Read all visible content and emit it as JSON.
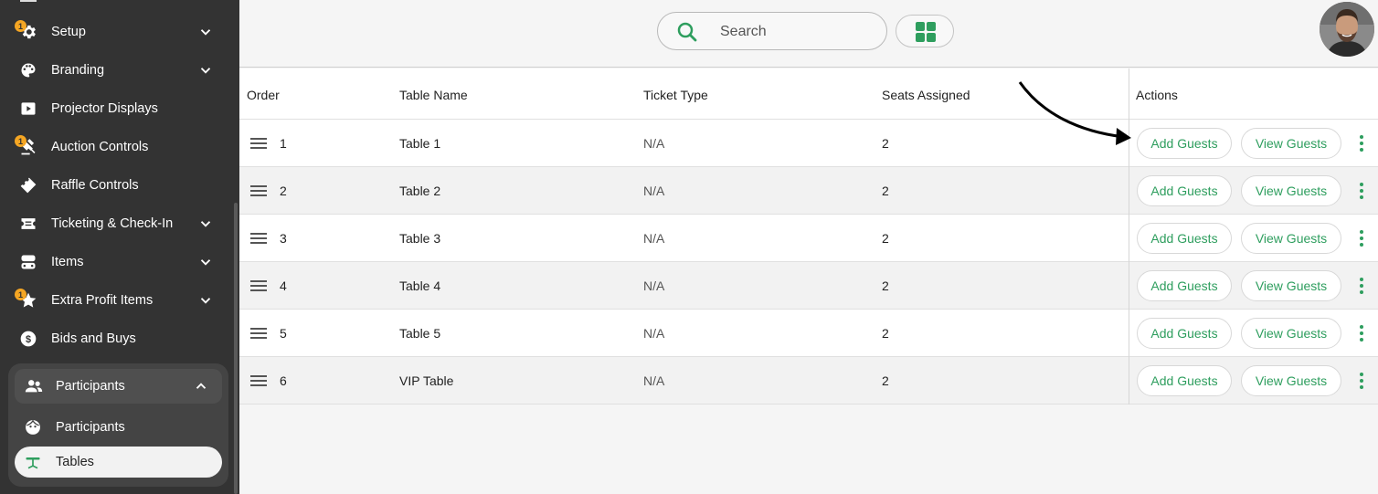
{
  "sidebar": {
    "items": [
      {
        "label": "Setup",
        "icon": "gear-icon",
        "chevron": true,
        "badge": "1"
      },
      {
        "label": "Branding",
        "icon": "palette-icon",
        "chevron": true
      },
      {
        "label": "Projector Displays",
        "icon": "play-icon",
        "chevron": false
      },
      {
        "label": "Auction Controls",
        "icon": "gavel-icon",
        "chevron": false,
        "badge": "1"
      },
      {
        "label": "Raffle Controls",
        "icon": "ticket-icon",
        "chevron": false
      },
      {
        "label": "Ticketing & Check-In",
        "icon": "ticketing-icon",
        "chevron": true
      },
      {
        "label": "Items",
        "icon": "items-icon",
        "chevron": true
      },
      {
        "label": "Extra Profit Items",
        "icon": "star-icon",
        "chevron": true,
        "badge": "1"
      },
      {
        "label": "Bids and Buys",
        "icon": "dollar-icon",
        "chevron": false
      }
    ],
    "group": {
      "label": "Participants",
      "icon": "people-icon",
      "children": [
        {
          "label": "Participants",
          "icon": "face-icon"
        },
        {
          "label": "Tables",
          "icon": "table-icon",
          "active": true
        }
      ]
    }
  },
  "topbar": {
    "search_placeholder": "Search"
  },
  "table": {
    "headers": {
      "order": "Order",
      "name": "Table Name",
      "ticket": "Ticket Type",
      "seats": "Seats Assigned",
      "actions": "Actions"
    },
    "rows": [
      {
        "order": "1",
        "name": "Table 1",
        "ticket": "N/A",
        "seats": "2"
      },
      {
        "order": "2",
        "name": "Table 2",
        "ticket": "N/A",
        "seats": "2"
      },
      {
        "order": "3",
        "name": "Table 3",
        "ticket": "N/A",
        "seats": "2"
      },
      {
        "order": "4",
        "name": "Table 4",
        "ticket": "N/A",
        "seats": "2"
      },
      {
        "order": "5",
        "name": "Table 5",
        "ticket": "N/A",
        "seats": "2"
      },
      {
        "order": "6",
        "name": "VIP Table",
        "ticket": "N/A",
        "seats": "2"
      }
    ],
    "add_label": "Add Guests",
    "view_label": "View Guests"
  },
  "colors": {
    "sidebar_bg": "#333333",
    "accent_green": "#2e9e5e",
    "badge": "#f5a623"
  }
}
